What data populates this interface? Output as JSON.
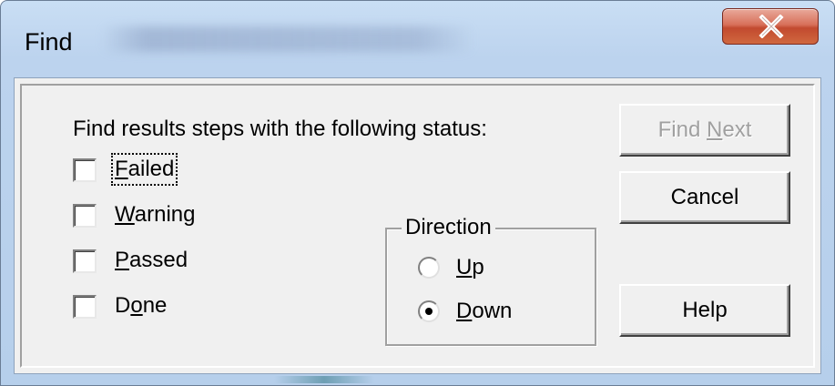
{
  "window": {
    "title": "Find",
    "close_glyph": "X",
    "colors": {
      "frame": "#b6cfeb",
      "client": "#f0f0f0",
      "close": "#c24a2f"
    }
  },
  "prompt": {
    "label": "Find results steps with the following status:"
  },
  "status_checkboxes": [
    {
      "key": "F",
      "rest": "ailed",
      "checked": false,
      "focused": true
    },
    {
      "key": "W",
      "rest": "arning",
      "checked": false,
      "focused": false
    },
    {
      "key": "P",
      "rest": "assed",
      "checked": false,
      "focused": false
    },
    {
      "pre": "D",
      "key": "o",
      "rest": "ne",
      "checked": false,
      "focused": false
    }
  ],
  "direction": {
    "label": "Direction",
    "options": [
      {
        "key": "U",
        "rest": "p",
        "selected": false
      },
      {
        "key": "D",
        "rest": "own",
        "selected": true
      }
    ]
  },
  "buttons": {
    "find_next": {
      "pre": "Find ",
      "key": "N",
      "rest": "ext",
      "enabled": false
    },
    "cancel": {
      "label": "Cancel"
    },
    "help": {
      "label": "Help"
    }
  }
}
